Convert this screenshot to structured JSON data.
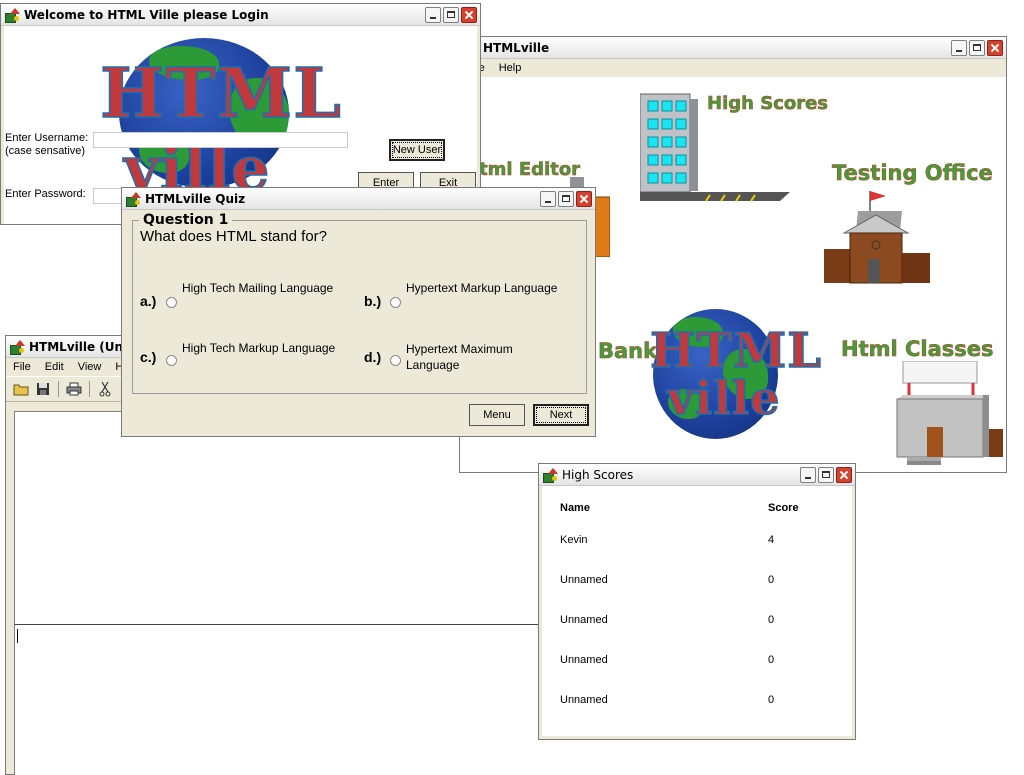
{
  "login": {
    "title": "Welcome to HTML Ville please Login",
    "logo_top": "HTML",
    "logo_bottom": "ville",
    "username_label": "Enter Username:",
    "username_hint": "(case sensative)",
    "password_label": "Enter Password:",
    "new_user_button": "New User",
    "enter_button": "Enter",
    "exit_button": "Exit"
  },
  "main": {
    "title": "HTMLville",
    "menu": [
      "File",
      "Help"
    ],
    "places": {
      "high_scores": "High Scores",
      "html_editor": "Html Editor",
      "testing_office": "Testing Office",
      "bank": "Bank",
      "html_classes": "Html Classes"
    },
    "logo_top": "HTML",
    "logo_bottom": "ville"
  },
  "editor": {
    "title": "HTMLville (Unt",
    "menu": [
      "File",
      "Edit",
      "View",
      "He"
    ]
  },
  "quiz": {
    "title": "HTMLville Quiz",
    "question_label": "Question 1",
    "question_text": "What does HTML stand for?",
    "options": [
      {
        "key": "a.)",
        "text": "High Tech Mailing Language"
      },
      {
        "key": "b.)",
        "text": "Hypertext Markup Language"
      },
      {
        "key": "c.)",
        "text": "High Tech Markup Language"
      },
      {
        "key": "d.)",
        "text": "Hypertext Maximum Language"
      }
    ],
    "menu_button": "Menu",
    "next_button": "Next"
  },
  "high_scores": {
    "title": "High Scores",
    "col_name": "Name",
    "col_score": "Score",
    "rows": [
      {
        "name": "Kevin",
        "score": "4"
      },
      {
        "name": "Unnamed",
        "score": "0"
      },
      {
        "name": "Unnamed",
        "score": "0"
      },
      {
        "name": "Unnamed",
        "score": "0"
      },
      {
        "name": "Unnamed",
        "score": "0"
      }
    ]
  },
  "colors": {
    "logo_red": "#c0393c",
    "logo_blue": "#1c6fb0",
    "place_green": "#3aa23a",
    "close_red": "#d6402e"
  }
}
